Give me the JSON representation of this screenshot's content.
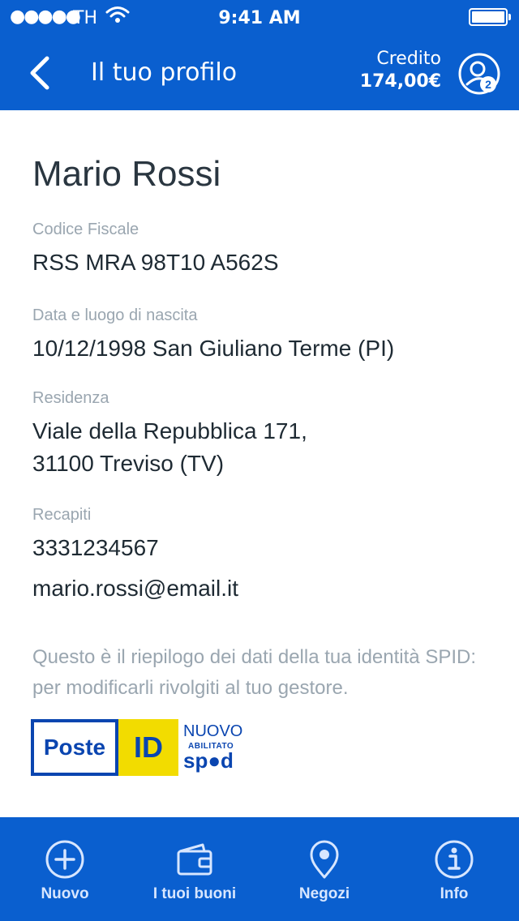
{
  "status_bar": {
    "carrier": "TH",
    "time": "9:41 AM",
    "signal_dots": "●●●●●"
  },
  "nav": {
    "title": "Il tuo profilo",
    "credit_label": "Credito",
    "credit_value": "174,00€",
    "profile_badge": "2",
    "back_icon": "chevron-left-icon",
    "profile_icon": "user-icon"
  },
  "profile": {
    "name": "Mario Rossi",
    "fiscal_code_label": "Codice Fiscale",
    "fiscal_code": "RSS MRA 98T10 A562S",
    "birth_label": "Data e luogo di nascita",
    "birth_value": "10/12/1998 San Giuliano Terme (PI)",
    "residence_label": "Residenza",
    "residence_line1": "Viale della Repubblica 171,",
    "residence_line2": "31100 Treviso (TV)",
    "contacts_label": "Recapiti",
    "phone": "3331234567",
    "email": "mario.rossi@email.it"
  },
  "note": "Questo è il riepilogo dei dati della tua identità SPID: per modificarli rivolgiti al tuo gestore.",
  "logo": {
    "poste": "Poste",
    "id": "ID",
    "nuovo": "NUOVO",
    "abilitato": "ABILITATO",
    "spid": "sp●d"
  },
  "tabs": [
    {
      "label": "Nuovo",
      "icon": "plus-circle-icon"
    },
    {
      "label": "I tuoi buoni",
      "icon": "wallet-icon"
    },
    {
      "label": "Negozi",
      "icon": "map-pin-icon"
    },
    {
      "label": "Info",
      "icon": "info-icon"
    }
  ],
  "colors": {
    "primary": "#0a5fcf",
    "label_gray": "#9aa6b0",
    "logo_blue": "#0a45b0",
    "logo_yellow": "#f2dc00"
  }
}
